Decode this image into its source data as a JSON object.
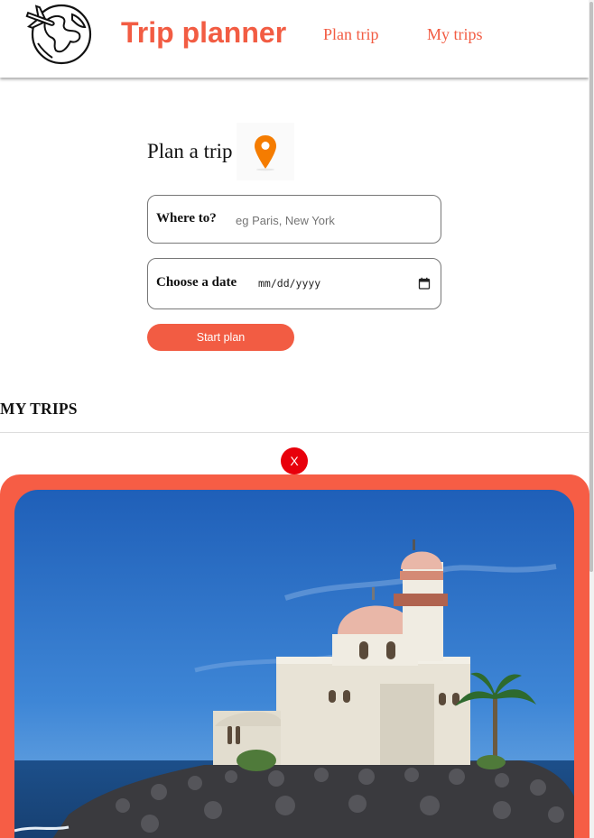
{
  "header": {
    "logo_icon": "globe-airplane-icon",
    "brand": "Trip planner",
    "nav": {
      "plan_trip": "Plan trip",
      "my_trips": "My trips"
    }
  },
  "plan": {
    "title": "Plan a trip",
    "title_icon": "location-pin-icon",
    "where": {
      "label": "Where to?",
      "placeholder": "eg Paris, New York",
      "value": ""
    },
    "date": {
      "label": "Choose a date",
      "value": "mm/dd/yyyy",
      "icon": "calendar-icon"
    },
    "start_button": "Start plan"
  },
  "trips": {
    "heading": "MY TRIPS",
    "close_label": "X",
    "image": "mosque-by-sea-photo"
  },
  "colors": {
    "accent": "#f25c43",
    "card": "#f65d45",
    "close": "#e8000b",
    "pin": "#f57c00"
  }
}
